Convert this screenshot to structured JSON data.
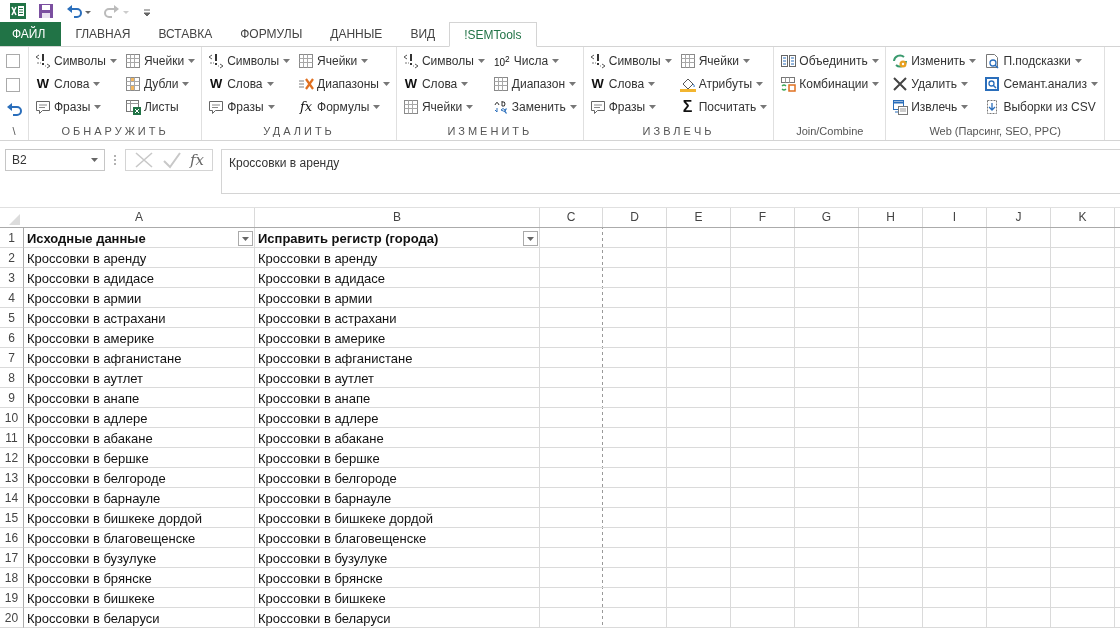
{
  "quick_access": [
    {
      "kind": "excel"
    },
    {
      "kind": "save"
    },
    {
      "kind": "undo",
      "disabled": false
    },
    {
      "kind": "redo",
      "disabled": true
    },
    {
      "kind": "customize"
    }
  ],
  "tabs": [
    {
      "label": "ФАЙЛ",
      "kind": "file",
      "selected": false
    },
    {
      "label": "ГЛАВНАЯ",
      "kind": "tab",
      "selected": false
    },
    {
      "label": "ВСТАВКА",
      "kind": "tab",
      "selected": false
    },
    {
      "label": "ФОРМУЛЫ",
      "kind": "tab",
      "selected": false
    },
    {
      "label": "ДАННЫЕ",
      "kind": "tab",
      "selected": false
    },
    {
      "label": "ВИД",
      "kind": "tab",
      "selected": false
    },
    {
      "label": "!SEMTools",
      "kind": "tab",
      "selected": true
    }
  ],
  "ribbon": {
    "groups": [
      {
        "label": "\\",
        "spaced": false,
        "columns": [
          [
            {
              "kind": "checkbox",
              "checked": false
            },
            {
              "kind": "checkbox",
              "checked": false
            },
            {
              "kind": "undo"
            }
          ]
        ]
      },
      {
        "label": "ОБНАРУЖИТЬ",
        "spaced": true,
        "columns": [
          [
            {
              "kind": "symbols",
              "label": "Символы",
              "dropdown": true
            },
            {
              "kind": "word",
              "glyph": "W",
              "label": "Слова",
              "dropdown": true
            },
            {
              "kind": "phrases",
              "label": "Фразы",
              "dropdown": true
            }
          ],
          [
            {
              "kind": "cells",
              "label": "Ячейки",
              "dropdown": true
            },
            {
              "kind": "duplicates",
              "label": "Дубли",
              "dropdown": true
            },
            {
              "kind": "sheets",
              "label": "Листы",
              "dropdown": false
            }
          ]
        ]
      },
      {
        "label": "УДАЛИТЬ",
        "spaced": true,
        "columns": [
          [
            {
              "kind": "symbols",
              "label": "Символы",
              "dropdown": true
            },
            {
              "kind": "word",
              "glyph": "W",
              "label": "Слова",
              "dropdown": true
            },
            {
              "kind": "phrases",
              "label": "Фразы",
              "dropdown": true
            }
          ],
          [
            {
              "kind": "cells",
              "label": "Ячейки",
              "dropdown": true
            },
            {
              "kind": "ranges",
              "label": "Диапазоны",
              "dropdown": true
            },
            {
              "kind": "formula",
              "glyph": "fx",
              "label": "Формулы",
              "dropdown": true
            }
          ]
        ]
      },
      {
        "label": "ИЗМЕНИТЬ",
        "spaced": true,
        "columns": [
          [
            {
              "kind": "symbols",
              "label": "Символы",
              "dropdown": true
            },
            {
              "kind": "word",
              "glyph": "W",
              "label": "Слова",
              "dropdown": true
            },
            {
              "kind": "cells",
              "label": "Ячейки",
              "dropdown": true
            }
          ],
          [
            {
              "kind": "numbers",
              "glyph": "10$^{2}$",
              "label": "Числа",
              "dropdown": true
            },
            {
              "kind": "cells",
              "label": "Диапазон",
              "dropdown": true
            },
            {
              "kind": "replace",
              "label": "Заменить",
              "dropdown": true
            }
          ]
        ]
      },
      {
        "label": "ИЗВЛЕЧЬ",
        "spaced": true,
        "columns": [
          [
            {
              "kind": "symbols",
              "label": "Символы",
              "dropdown": true
            },
            {
              "kind": "word",
              "glyph": "W",
              "label": "Слова",
              "dropdown": true
            },
            {
              "kind": "phrases",
              "label": "Фразы",
              "dropdown": true
            }
          ],
          [
            {
              "kind": "cells",
              "label": "Ячейки",
              "dropdown": true
            },
            {
              "kind": "attributes",
              "label": "Атрибуты",
              "dropdown": true
            },
            {
              "kind": "sum",
              "glyph": "Σ",
              "label": "Посчитать",
              "dropdown": true
            }
          ]
        ]
      },
      {
        "label": "Join/Combine",
        "spaced": false,
        "columns": [
          [
            {
              "kind": "merge",
              "label": "Объединить",
              "dropdown": true
            },
            {
              "kind": "combos",
              "label": "Комбинации",
              "dropdown": true
            }
          ]
        ]
      },
      {
        "label": "Web (Парсинг, SEO, PPC)",
        "spaced": false,
        "columns": [
          [
            {
              "kind": "edit",
              "label": "Изменить",
              "dropdown": true
            },
            {
              "kind": "delete",
              "label": "Удалить",
              "dropdown": true
            },
            {
              "kind": "extract",
              "label": "Извлечь",
              "dropdown": true
            }
          ],
          [
            {
              "kind": "hints",
              "label": "П.подсказки",
              "dropdown": true
            },
            {
              "kind": "analysis",
              "label": "Семант.анализ",
              "dropdown": true
            },
            {
              "kind": "csv",
              "label": "Выборки из CSV",
              "dropdown": false
            }
          ]
        ]
      }
    ]
  },
  "formula_bar": {
    "name_box": "B2",
    "fx": "fx",
    "value": "Кроссовки в аренду"
  },
  "sheet": {
    "columns": [
      "A",
      "B",
      "C",
      "D",
      "E",
      "F",
      "G",
      "H",
      "I",
      "J",
      "K"
    ],
    "header_row": {
      "number": "1",
      "cells": [
        {
          "text": "Исходные данные",
          "filter": true
        },
        {
          "text": "Исправить регистр (города)",
          "filter": true
        }
      ]
    },
    "rows": [
      {
        "number": "2",
        "cells": [
          "Кроссовки в аренду",
          "Кроссовки в аренду"
        ]
      },
      {
        "number": "3",
        "cells": [
          "Кроссовки в адидасе",
          "Кроссовки в адидасе"
        ]
      },
      {
        "number": "4",
        "cells": [
          "Кроссовки в армии",
          "Кроссовки в армии"
        ]
      },
      {
        "number": "5",
        "cells": [
          "Кроссовки в астрахани",
          "Кроссовки в астрахани"
        ]
      },
      {
        "number": "6",
        "cells": [
          "Кроссовки в америке",
          "Кроссовки в америке"
        ]
      },
      {
        "number": "7",
        "cells": [
          "Кроссовки в афганистане",
          "Кроссовки в афганистане"
        ]
      },
      {
        "number": "8",
        "cells": [
          "Кроссовки в аутлет",
          "Кроссовки в аутлет"
        ]
      },
      {
        "number": "9",
        "cells": [
          "Кроссовки в анапе",
          "Кроссовки в анапе"
        ]
      },
      {
        "number": "10",
        "cells": [
          "Кроссовки в адлере",
          "Кроссовки в адлере"
        ]
      },
      {
        "number": "11",
        "cells": [
          "Кроссовки в абакане",
          "Кроссовки в абакане"
        ]
      },
      {
        "number": "12",
        "cells": [
          "Кроссовки в бершке",
          "Кроссовки в бершке"
        ]
      },
      {
        "number": "13",
        "cells": [
          "Кроссовки в белгороде",
          "Кроссовки в белгороде"
        ]
      },
      {
        "number": "14",
        "cells": [
          "Кроссовки в барнауле",
          "Кроссовки в барнауле"
        ]
      },
      {
        "number": "15",
        "cells": [
          "Кроссовки в бишкеке дордой",
          "Кроссовки в бишкеке дордой"
        ]
      },
      {
        "number": "16",
        "cells": [
          "Кроссовки в благовещенске",
          "Кроссовки в благовещенске"
        ]
      },
      {
        "number": "17",
        "cells": [
          "Кроссовки в бузулуке",
          "Кроссовки в бузулуке"
        ]
      },
      {
        "number": "18",
        "cells": [
          "Кроссовки в брянске",
          "Кроссовки в брянске"
        ]
      },
      {
        "number": "19",
        "cells": [
          "Кроссовки в бишкеке",
          "Кроссовки в бишкеке"
        ]
      },
      {
        "number": "20",
        "cells": [
          "Кроссовки в беларуси",
          "Кроссовки в беларуси"
        ]
      }
    ]
  }
}
